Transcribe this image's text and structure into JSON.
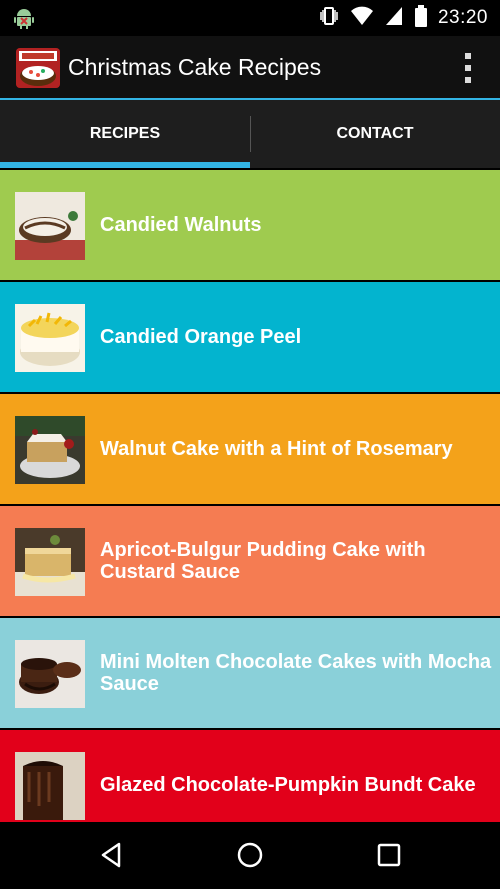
{
  "status_bar": {
    "time": "23:20",
    "icons": [
      "android-debug-icon",
      "vibrate-icon",
      "wifi-icon",
      "signal-icon",
      "battery-icon"
    ]
  },
  "action_bar": {
    "title": "Christmas Cake Recipes",
    "accent": "#33b5e5"
  },
  "tabs": [
    {
      "label": "RECIPES",
      "selected": true
    },
    {
      "label": "CONTACT",
      "selected": false
    }
  ],
  "recipes": [
    {
      "title": "Candied Walnuts",
      "color": "#9fcb4f"
    },
    {
      "title": "Candied Orange Peel",
      "color": "#03b4cf"
    },
    {
      "title": "Walnut Cake with a Hint of Rosemary",
      "color": "#f4a21a"
    },
    {
      "title": "Apricot-Bulgur Pudding Cake with Custard Sauce",
      "color": "#f57c52"
    },
    {
      "title": "Mini Molten Chocolate Cakes with Mocha Sauce",
      "color": "#8ad0d9"
    },
    {
      "title": "Glazed Chocolate-Pumpkin Bundt Cake",
      "color": "#e2001a"
    }
  ],
  "nav_bar": {
    "icons": [
      "back-icon",
      "home-icon",
      "recents-icon"
    ]
  }
}
